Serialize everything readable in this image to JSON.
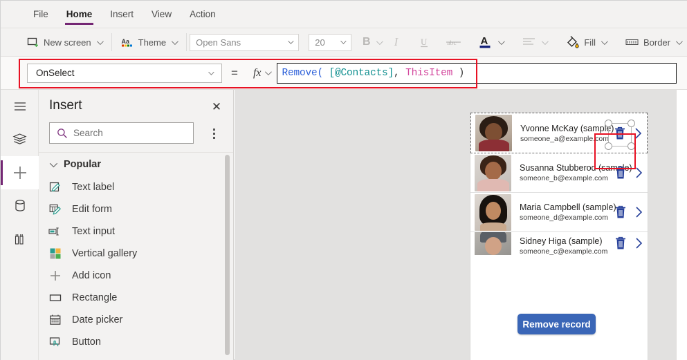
{
  "menubar": {
    "items": [
      {
        "label": "File",
        "active": false
      },
      {
        "label": "Home",
        "active": true
      },
      {
        "label": "Insert",
        "active": false
      },
      {
        "label": "View",
        "active": false
      },
      {
        "label": "Action",
        "active": false
      }
    ]
  },
  "ribbon": {
    "new_screen": "New screen",
    "theme": "Theme",
    "font_family": "Open Sans",
    "font_size": "20",
    "bold": "B",
    "italic": "I",
    "underline": "U",
    "strikethrough": "abc",
    "font_color": "A",
    "align": "align-icon",
    "fill": "Fill",
    "border": "Border"
  },
  "formula_bar": {
    "property": "OnSelect",
    "equals": "=",
    "fx": "fx",
    "formula_full": "Remove( [@Contacts], ThisItem )",
    "tokens": [
      {
        "text": "Remove(",
        "kind": "fn"
      },
      {
        "text": " ",
        "kind": "plain"
      },
      {
        "text": "[@Contacts]",
        "kind": "table"
      },
      {
        "text": ",",
        "kind": "plain"
      },
      {
        "text": " ",
        "kind": "plain"
      },
      {
        "text": "ThisItem",
        "kind": "this"
      },
      {
        "text": " )",
        "kind": "plain"
      }
    ],
    "highlight_color": "#e81123"
  },
  "rail": {
    "items": [
      {
        "name": "menu-icon",
        "active": false
      },
      {
        "name": "tree-view-icon",
        "active": false
      },
      {
        "name": "insert-plus-icon",
        "active": true
      },
      {
        "name": "data-icon",
        "active": false
      },
      {
        "name": "media-icon",
        "active": false
      }
    ],
    "accent_color": "#742774"
  },
  "insert_panel": {
    "title": "Insert",
    "close_label": "✕",
    "search_placeholder": "Search",
    "group_label": "Popular",
    "items": [
      {
        "label": "Text label",
        "icon": "text-label-icon"
      },
      {
        "label": "Edit form",
        "icon": "edit-form-icon"
      },
      {
        "label": "Text input",
        "icon": "text-input-icon"
      },
      {
        "label": "Vertical gallery",
        "icon": "vertical-gallery-icon"
      },
      {
        "label": "Add icon",
        "icon": "add-icon"
      },
      {
        "label": "Rectangle",
        "icon": "rectangle-icon"
      },
      {
        "label": "Date picker",
        "icon": "date-picker-icon"
      },
      {
        "label": "Button",
        "icon": "button-icon"
      }
    ]
  },
  "canvas": {
    "gallery": {
      "rows": [
        {
          "name": "Yvonne McKay (sample)",
          "email": "someone_a@example.com",
          "selected": true,
          "photo": "p1"
        },
        {
          "name": "Susanna Stubberod (sample)",
          "email": "someone_b@example.com",
          "selected": false,
          "photo": "p2"
        },
        {
          "name": "Maria Campbell (sample)",
          "email": "someone_d@example.com",
          "selected": false,
          "photo": "p3"
        },
        {
          "name": "Sidney Higa (sample)",
          "email": "someone_c@example.com",
          "selected": false,
          "photo": "p4"
        }
      ],
      "trash_icon": "trash-icon",
      "next_icon": "chevron-right-icon",
      "icon_color": "#27409a"
    },
    "remove_button": {
      "label": "Remove record",
      "color": "#3a66b7"
    }
  }
}
